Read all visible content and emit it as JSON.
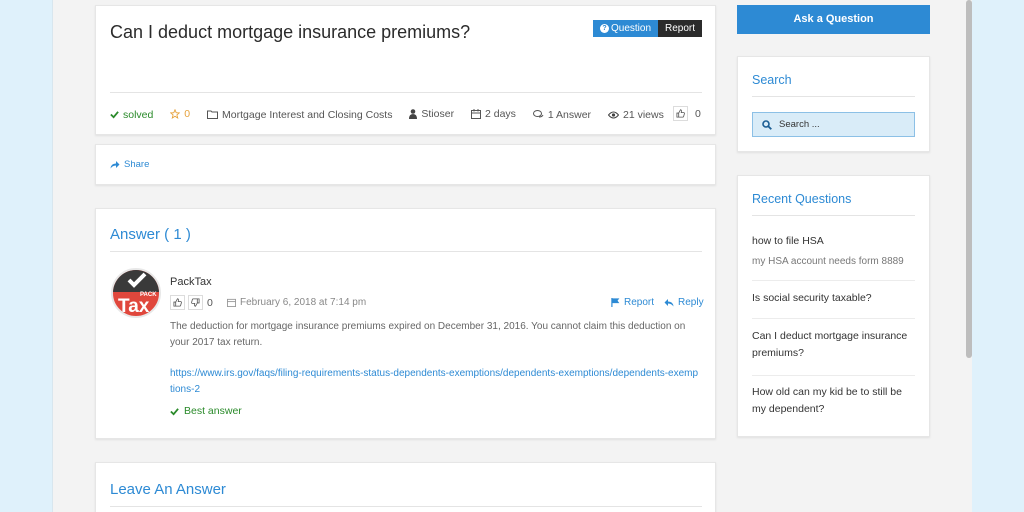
{
  "question": {
    "title": "Can I deduct mortgage insurance premiums?",
    "type_badge": "Question",
    "report_button": "Report",
    "status": "solved",
    "favorites": "0",
    "category": "Mortgage Interest and Closing Costs",
    "author": "Stioser",
    "time": "2 days",
    "answers": "1 Answer",
    "views": "21 views",
    "votes": "0"
  },
  "share": {
    "label": "Share"
  },
  "answers_section": {
    "title": "Answer ( 1 )",
    "answer": {
      "author": "PackTax",
      "avatar_small_text": "PACK",
      "avatar_big_text": "Tax",
      "votes": "0",
      "date": "February 6, 2018 at 7:14 pm",
      "report": "Report",
      "reply": "Reply",
      "body": "The deduction for mortgage insurance premiums expired on December 31, 2016. You cannot claim this deduction on your 2017 tax return.",
      "link": "https://www.irs.gov/faqs/filing-requirements-status-dependents-exemptions/dependents-exemptions/dependents-exemptions-2",
      "best_answer": "Best answer"
    }
  },
  "leave_answer": {
    "title": "Leave An Answer"
  },
  "sidebar": {
    "ask_button": "Ask a Question",
    "search": {
      "title": "Search",
      "placeholder": "Search ..."
    },
    "recent": {
      "title": "Recent Questions",
      "items": [
        {
          "title": "how to file HSA",
          "subtitle": "my HSA account needs form 8889"
        },
        {
          "title": "Is social security taxable?"
        },
        {
          "title": "Can I deduct mortgage insurance premiums?"
        },
        {
          "title": "How old can my kid be to still be my dependent?"
        }
      ]
    }
  },
  "colors": {
    "accent": "#2d8ad4",
    "success": "#2a8a2a",
    "dark": "#2b2b2b",
    "avatar_red": "#e0473c"
  }
}
